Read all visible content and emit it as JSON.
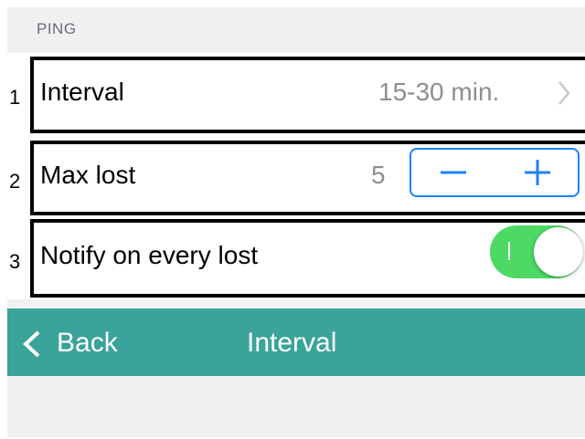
{
  "section": {
    "title": "PING"
  },
  "rows": [
    {
      "number": "1",
      "label": "Interval",
      "value": "15-30 min."
    },
    {
      "number": "2",
      "label": "Max lost",
      "value": "5"
    },
    {
      "number": "3",
      "label": "Notify on every lost",
      "toggle_on": true
    }
  ],
  "navbar": {
    "back_label": "Back",
    "title": "Interval"
  },
  "colors": {
    "accent_blue": "#1a82fb",
    "toggle_green": "#4cd964",
    "navbar_teal": "#3aa39a"
  },
  "icons": [
    "chevron-right-icon",
    "minus-icon",
    "plus-icon",
    "chevron-left-icon"
  ]
}
